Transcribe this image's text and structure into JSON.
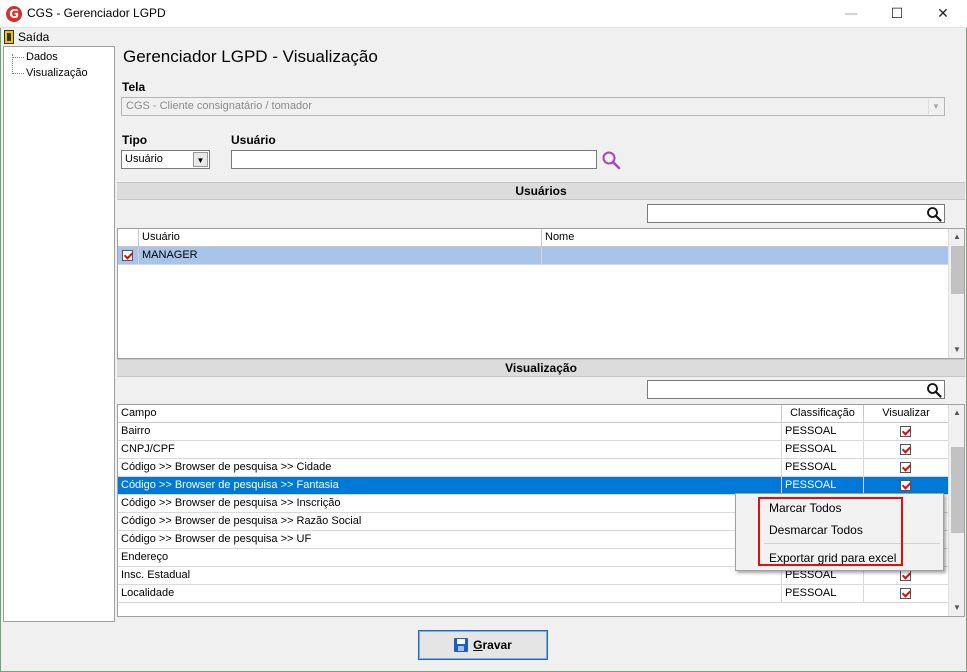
{
  "window": {
    "title": "CGS - Gerenciador LGPD",
    "logo_letter": "G"
  },
  "controls": {
    "minimize": "—",
    "maximize": "☐",
    "close": "✕"
  },
  "menu": {
    "saida": "Saída"
  },
  "tree": {
    "items": [
      "Dados",
      "Visualização"
    ]
  },
  "page": {
    "title": "Gerenciador LGPD - Visualização"
  },
  "tela": {
    "label": "Tela",
    "value": "CGS - Cliente consignatário / tomador"
  },
  "tipo": {
    "label": "Tipo",
    "value": "Usuário"
  },
  "usuario": {
    "label": "Usuário",
    "value": ""
  },
  "usuarios_section": {
    "title": "Usuários",
    "filter": "",
    "columns": [
      "Usuário",
      "Nome"
    ],
    "rows": [
      {
        "checked": true,
        "usuario": "MANAGER",
        "nome": ""
      }
    ]
  },
  "visualizacao_section": {
    "title": "Visualização",
    "filter": "",
    "columns": [
      "Campo",
      "Classificação",
      "Visualizar"
    ],
    "rows": [
      {
        "campo": "Bairro",
        "classificacao": "PESSOAL",
        "visualizar": true
      },
      {
        "campo": "CNPJ/CPF",
        "classificacao": "PESSOAL",
        "visualizar": true
      },
      {
        "campo": "Código >> Browser de pesquisa >> Cidade",
        "classificacao": "PESSOAL",
        "visualizar": true
      },
      {
        "campo": "Código >> Browser de pesquisa >> Fantasia",
        "classificacao": "PESSOAL",
        "visualizar": true
      },
      {
        "campo": "Código >> Browser de pesquisa >> Inscrição",
        "classificacao": "",
        "visualizar": null
      },
      {
        "campo": "Código >> Browser de pesquisa >> Razão Social",
        "classificacao": "",
        "visualizar": null
      },
      {
        "campo": "Código >> Browser de pesquisa >> UF",
        "classificacao": "",
        "visualizar": null
      },
      {
        "campo": "Endereço",
        "classificacao": "",
        "visualizar": null
      },
      {
        "campo": "Insc. Estadual",
        "classificacao": "PESSOAL",
        "visualizar": true
      },
      {
        "campo": "Localidade",
        "classificacao": "PESSOAL",
        "visualizar": true
      }
    ]
  },
  "context_menu": {
    "items": [
      "Marcar Todos",
      "Desmarcar Todos",
      "Exportar grid para excel"
    ],
    "highlight_color": "#e01010"
  },
  "footer": {
    "save_label": "Gravar"
  },
  "colors": {
    "selection": "#0078d7",
    "selection_inactive": "#a8c4ea",
    "check": "#d01010"
  }
}
